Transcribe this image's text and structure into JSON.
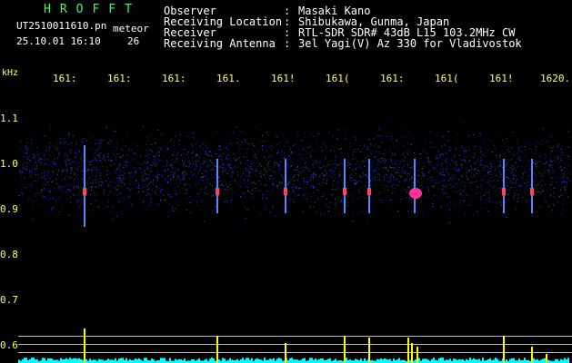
{
  "header": {
    "brand": "HROFFT",
    "filename": "UT2510011610.pn",
    "suffix": "meteor",
    "datetime": "25.10.01 16:10",
    "count": "26"
  },
  "info": [
    {
      "label": "Observer",
      "value": "Masaki Kano"
    },
    {
      "label": "Receiving Location",
      "value": "Shibukawa, Gunma, Japan"
    },
    {
      "label": "Receiver",
      "value": "RTL-SDR SDR# 43dB L15 103.2MHz CW"
    },
    {
      "label": "Receiving Antenna",
      "value": "3el Yagi(V) Az 330 for Vladivostok"
    }
  ],
  "axis": {
    "unit": "kHz",
    "x_ticks": [
      "161:",
      "161:",
      "161:",
      "161.",
      "161!",
      "161(",
      "161:",
      "161(",
      "161!",
      "1620."
    ],
    "y_ticks": [
      "1.1",
      "1.0",
      "0.9",
      "0.8",
      "0.7",
      "0.6"
    ]
  },
  "colors": {
    "label": "#ffffff",
    "axis": "#ffff66",
    "brand": "#33ff66",
    "spectrum": "#00ffff",
    "spike": "#ffff00"
  }
}
